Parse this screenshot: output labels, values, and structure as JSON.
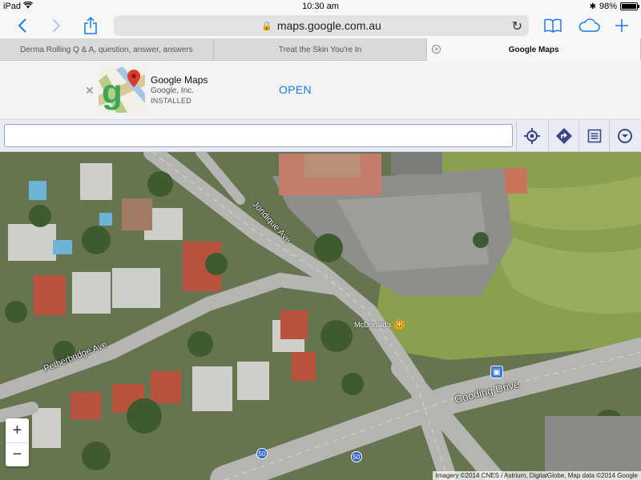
{
  "status_bar": {
    "device": "iPad",
    "time": "10:30 am",
    "battery": "98%",
    "battery_level": 0.98
  },
  "toolbar": {
    "url": "maps.google.com.au"
  },
  "tabs": [
    {
      "label": "Derma Rolling Q & A, question, answer, answers",
      "active": false
    },
    {
      "label": "Treat the Skin You're In",
      "active": false
    },
    {
      "label": "Google Maps",
      "active": true
    }
  ],
  "app_banner": {
    "name": "Google Maps",
    "developer": "Google, Inc.",
    "status": "INSTALLED",
    "open_label": "OPEN"
  },
  "maps_toolbar": {
    "search_value": "",
    "icons": [
      "locate-icon",
      "directions-icon",
      "list-icon",
      "menu-dropdown-icon"
    ]
  },
  "map": {
    "roads": [
      "Jondique Ave",
      "Petherbridge Ave",
      "Gooding Drive"
    ],
    "poi": "McDonald's",
    "route_shields": [
      "50",
      "50"
    ],
    "attribution": "Imagery ©2014 CNES / Astrium, DigitalGlobe, Map data ©2014 Google"
  },
  "colors": {
    "ios_blue": "#1a7bf0",
    "maps_bar": "#e9ecf4"
  }
}
